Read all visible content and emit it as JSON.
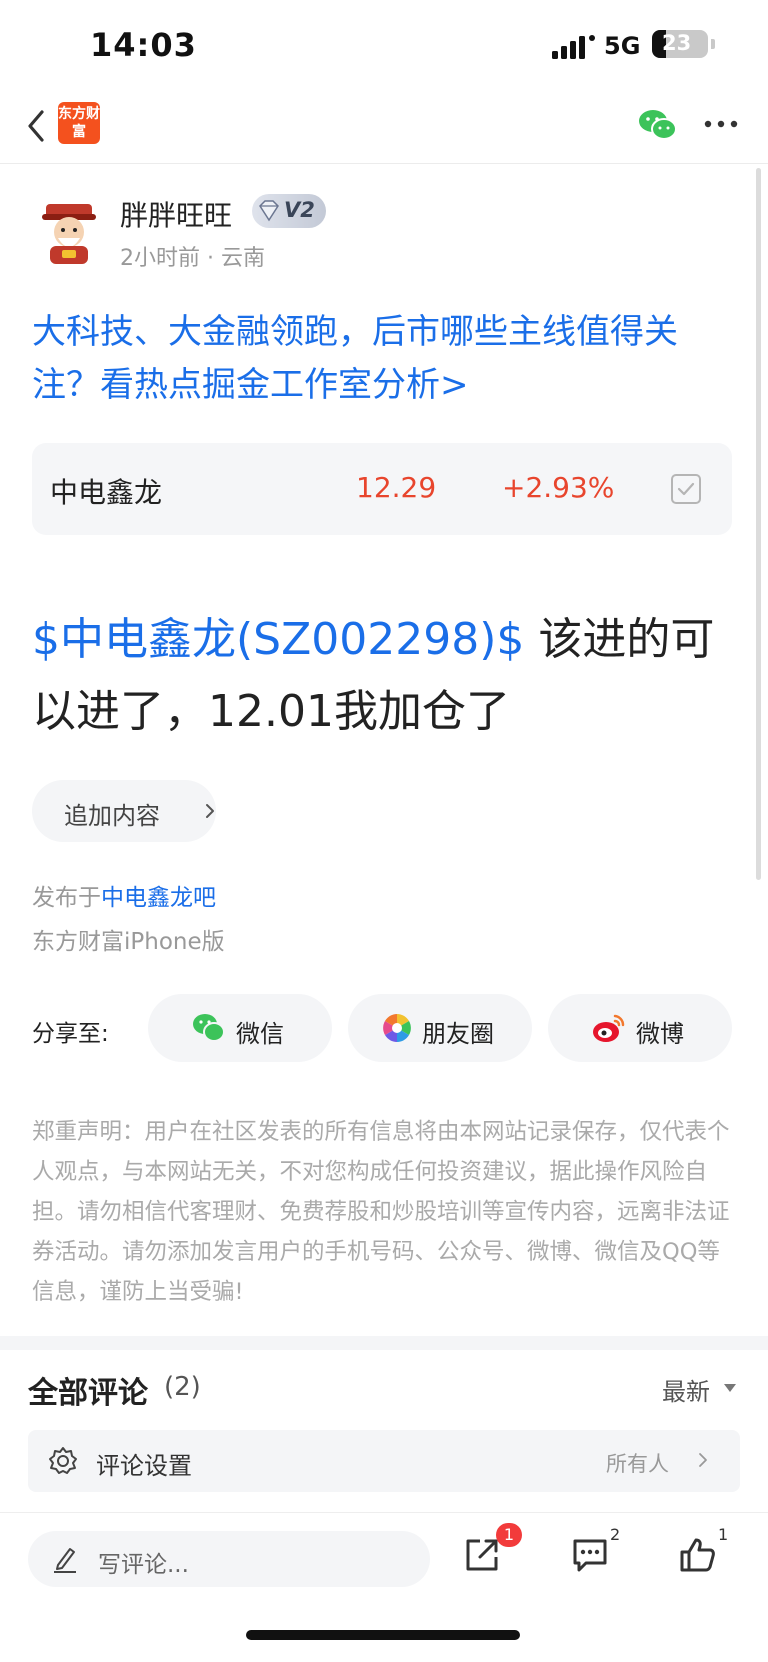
{
  "status_bar": {
    "time": "14:03",
    "network": "5G",
    "battery": "23"
  },
  "nav": {
    "logo_text": "东方财富"
  },
  "post": {
    "author": {
      "name": "胖胖旺旺",
      "level": "V2",
      "meta": "2小时前 · 云南"
    },
    "headline": "大科技、大金融领跑，后市哪些主线值得关注？看热点掘金工作室分析>",
    "stock_card": {
      "name": "中电鑫龙",
      "price": "12.29",
      "change": "+2.93%"
    },
    "body_tag": "$中电鑫龙(SZ002298)$",
    "body_text": "  该进的可以进了，12.01我加仓了",
    "add_content_label": "追加内容",
    "posted_in_prefix": "发布于",
    "posted_in_bar": "中电鑫龙吧",
    "client": "东方财富iPhone版"
  },
  "share": {
    "label": "分享至:",
    "wechat": "微信",
    "moments": "朋友圈",
    "weibo": "微博"
  },
  "disclaimer": "郑重声明：用户在社区发表的所有信息将由本网站记录保存，仅代表个人观点，与本网站无关，不对您构成任何投资建议，据此操作风险自担。请勿相信代客理财、免费荐股和炒股培训等宣传内容，远离非法证券活动。请勿添加发言用户的手机号码、公众号、微博、微信及QQ等信息，谨防上当受骗!",
  "comments": {
    "title": "全部评论",
    "count": "(2)",
    "sort": "最新",
    "settings_label": "评论设置",
    "settings_value": "所有人"
  },
  "bottom_bar": {
    "input_placeholder": "写评论...",
    "share_badge": "1",
    "comment_count": "2",
    "like_count": "1"
  },
  "colors": {
    "link_blue": "#1a6ee8",
    "up_red": "#e8452d",
    "brand_orange": "#f4511e"
  }
}
